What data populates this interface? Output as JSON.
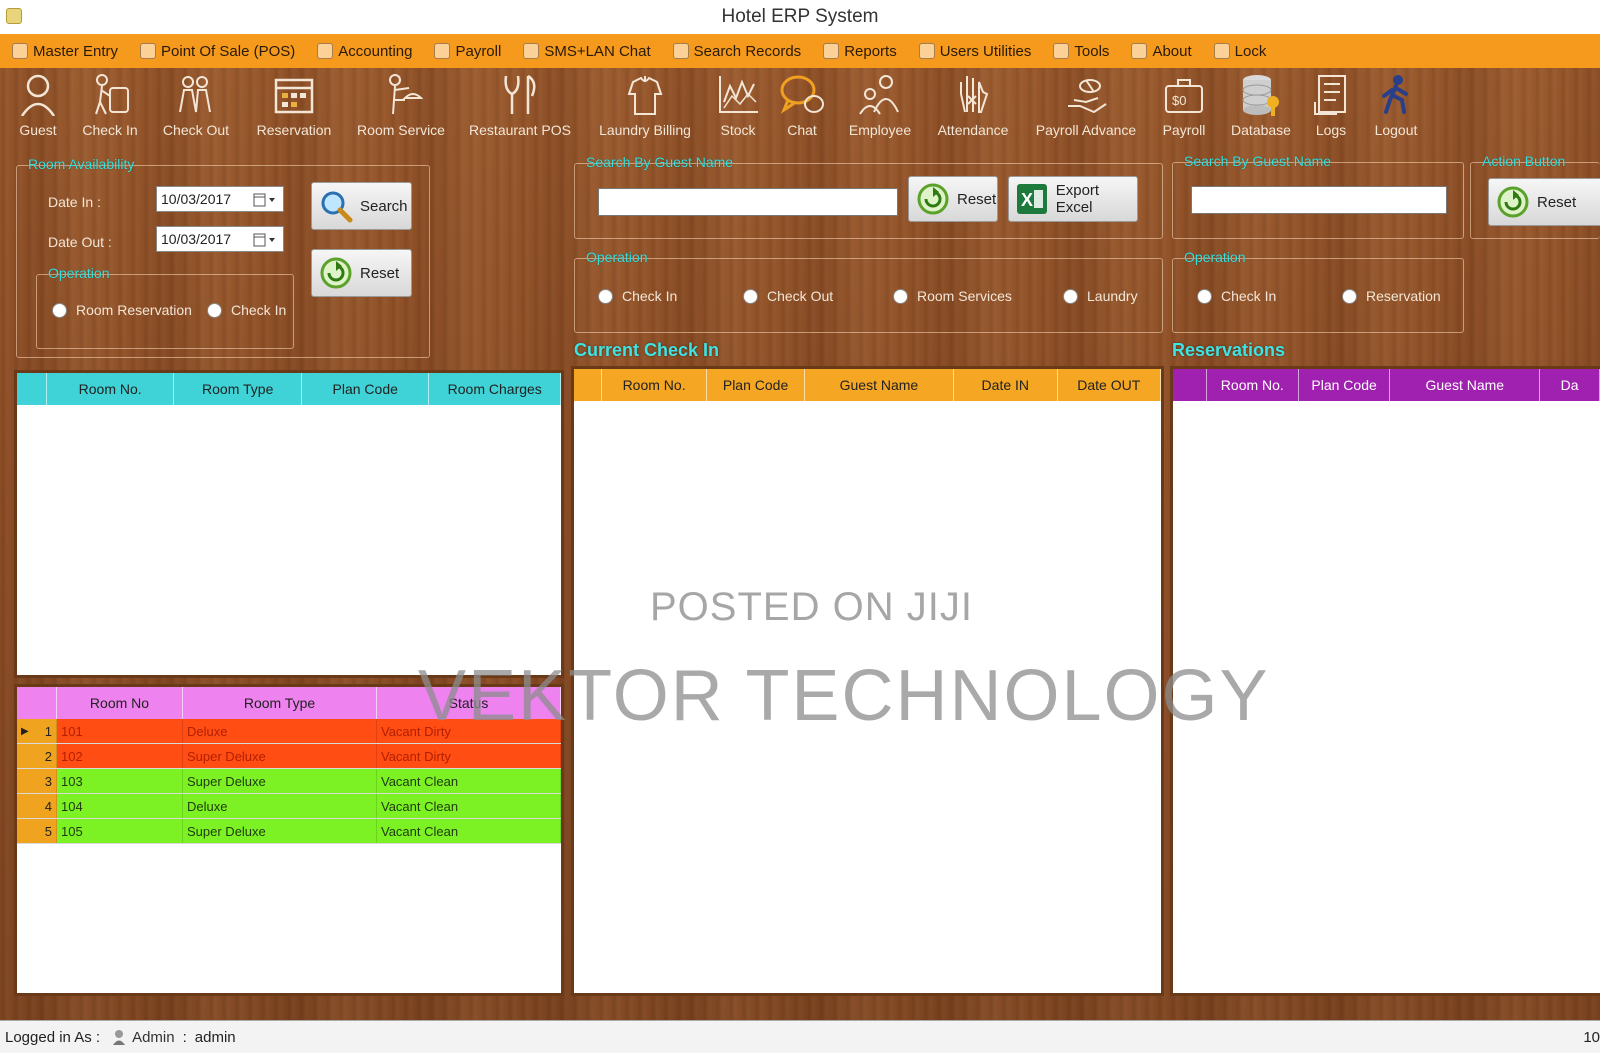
{
  "window": {
    "title": "Hotel ERP System"
  },
  "menu": [
    {
      "label": "Master Entry",
      "icon": "master-entry-icon"
    },
    {
      "label": "Point Of Sale (POS)",
      "icon": "pos-icon"
    },
    {
      "label": "Accounting",
      "icon": "accounting-icon"
    },
    {
      "label": "Payroll",
      "icon": "payroll-icon"
    },
    {
      "label": "SMS+LAN Chat",
      "icon": "chat-icon"
    },
    {
      "label": "Search Records",
      "icon": "search-icon"
    },
    {
      "label": "Reports",
      "icon": "reports-icon"
    },
    {
      "label": "Users Utilities",
      "icon": "users-icon"
    },
    {
      "label": "Tools",
      "icon": "tools-icon"
    },
    {
      "label": "About",
      "icon": "info-icon"
    },
    {
      "label": "Lock",
      "icon": "lock-icon"
    }
  ],
  "toolbar": [
    {
      "label": "Guest",
      "icon": "guest-icon"
    },
    {
      "label": "Check In",
      "icon": "check-in-icon"
    },
    {
      "label": "Check Out",
      "icon": "check-out-icon"
    },
    {
      "label": "Reservation",
      "icon": "calendar-icon"
    },
    {
      "label": "Room Service",
      "icon": "room-service-icon"
    },
    {
      "label": "Restaurant POS",
      "icon": "restaurant-icon"
    },
    {
      "label": "Laundry Billing",
      "icon": "laundry-icon"
    },
    {
      "label": "Stock",
      "icon": "stock-chart-icon"
    },
    {
      "label": "Chat",
      "icon": "chat-bubble-icon"
    },
    {
      "label": "Employee",
      "icon": "employee-icon"
    },
    {
      "label": "Attendance",
      "icon": "hand-icon"
    },
    {
      "label": "Payroll Advance",
      "icon": "money-hand-icon"
    },
    {
      "label": "Payroll",
      "icon": "toolbox-icon"
    },
    {
      "label": "Database",
      "icon": "database-icon"
    },
    {
      "label": "Logs",
      "icon": "logs-icon"
    },
    {
      "label": "Logout",
      "icon": "logout-icon"
    }
  ],
  "room_availability": {
    "title": "Room Availability",
    "date_in_label": "Date In :",
    "date_in_value": "10/03/2017",
    "date_out_label": "Date Out :",
    "date_out_value": "10/03/2017",
    "search_label": "Search",
    "reset_label": "Reset",
    "operation_title": "Operation",
    "radio_reservation": "Room Reservation",
    "radio_checkin": "Check In"
  },
  "checkin_search": {
    "title": "Search By Guest Name",
    "search_value": "",
    "reset_label": "Reset",
    "export_label": "Export Excel",
    "operation_title": "Operation",
    "radios": [
      "Check In",
      "Check Out",
      "Room Services",
      "Laundry"
    ]
  },
  "reservation_search": {
    "title": "Search By Guest Name",
    "search_value": "",
    "operation_title": "Operation",
    "radios": [
      "Check In",
      "Reservation"
    ],
    "action_title": "Action Button",
    "reset_label": "Reset"
  },
  "available_grid": {
    "columns": [
      "Room No.",
      "Room Type",
      "Plan Code",
      "Room Charges"
    ],
    "header_color": "#3fd2d6"
  },
  "status_grid": {
    "columns": [
      "Room No",
      "Room Type",
      "Status"
    ],
    "header_color": "#ee82ee",
    "rows": [
      {
        "idx": "1",
        "room": "101",
        "type": "Deluxe",
        "status": "Vacant Dirty",
        "state": "dirty"
      },
      {
        "idx": "2",
        "room": "102",
        "type": "Super Deluxe",
        "status": "Vacant Dirty",
        "state": "dirty"
      },
      {
        "idx": "3",
        "room": "103",
        "type": "Super Deluxe",
        "status": "Vacant Clean",
        "state": "clean"
      },
      {
        "idx": "4",
        "room": "104",
        "type": "Deluxe",
        "status": "Vacant Clean",
        "state": "clean"
      },
      {
        "idx": "5",
        "room": "105",
        "type": "Super Deluxe",
        "status": "Vacant Clean",
        "state": "clean"
      }
    ]
  },
  "current_checkin": {
    "title": "Current Check In",
    "columns": [
      "Room No.",
      "Plan Code",
      "Guest Name",
      "Date IN",
      "Date OUT"
    ],
    "header_color": "#f5a623"
  },
  "reservations": {
    "title": "Reservations",
    "columns": [
      "Room No.",
      "Plan Code",
      "Guest Name",
      "Da"
    ],
    "header_color": "#a020b0"
  },
  "statusbar": {
    "logged_label": "Logged in As :",
    "role": "Admin",
    "separator": ":",
    "user": "admin",
    "right": "10"
  },
  "watermark": {
    "line1": "POSTED ON JIJI",
    "line2": "VEKTOR TECHNOLOGY"
  }
}
